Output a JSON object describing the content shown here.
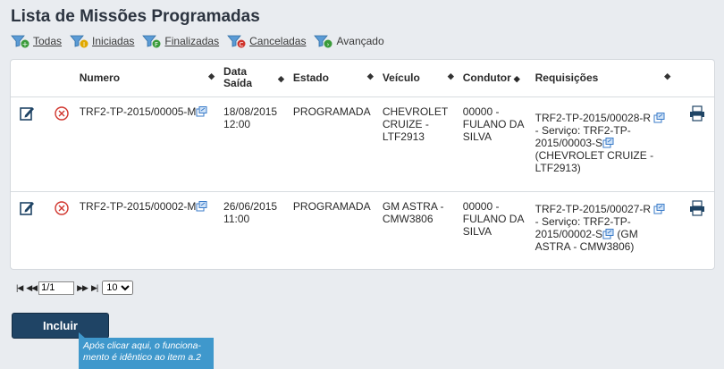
{
  "page_title": "Lista de Missões Programadas",
  "filters": [
    {
      "label": "Todas",
      "icon": "filter-green-plus-icon",
      "color": "#3a9b3a",
      "glyph": "+"
    },
    {
      "label": "Iniciadas",
      "icon": "filter-yellow-icon",
      "color": "#e0a800",
      "glyph": "I"
    },
    {
      "label": "Finalizadas",
      "icon": "filter-green-f-icon",
      "color": "#3a9b3a",
      "glyph": "F"
    },
    {
      "label": "Canceladas",
      "icon": "filter-red-icon",
      "color": "#d0342c",
      "glyph": "C"
    },
    {
      "label": "Avançado",
      "icon": "filter-advanced-icon",
      "color": "#3a9b3a",
      "glyph": "›"
    }
  ],
  "table": {
    "headers": {
      "numero": "Numero",
      "data_saida": "Data Saída",
      "estado": "Estado",
      "veiculo": "Veículo",
      "condutor": "Condutor",
      "requisicoes": "Requisições"
    },
    "rows": [
      {
        "numero": "TRF2-TP-2015/00005-M",
        "data_saida": "18/08/2015 12:00",
        "estado": "PROGRAMADA",
        "veiculo": "CHEVROLET CRUIZE - LTF2913",
        "condutor": "00000 - FULANO DA SILVA",
        "req_code": "TRF2-TP-2015/00028-R",
        "req_servico": " - Serviço: TRF2-TP-2015/00003-S",
        "req_detail": " (CHEVROLET CRUIZE - LTF2913)"
      },
      {
        "numero": "TRF2-TP-2015/00002-M",
        "data_saida": "26/06/2015 11:00",
        "estado": "PROGRAMADA",
        "veiculo": "GM ASTRA - CMW3806",
        "condutor": "00000 - FULANO DA SILVA",
        "req_code": "TRF2-TP-2015/00027-R",
        "req_servico": " - Serviço: TRF2-TP-2015/00002-S",
        "req_detail": " (GM ASTRA - CMW3806)"
      }
    ]
  },
  "pagination": {
    "page": "1/1",
    "page_size": "10",
    "page_size_options": [
      "10"
    ]
  },
  "incluir_button": "Incluir",
  "callout": "Após clicar aqui, o funciona-mento é idêntico ao item a.2",
  "colors": {
    "accent": "#1f4465",
    "callout": "#3f98cc",
    "edit": "#1f4465",
    "cancel": "#d0342c"
  }
}
